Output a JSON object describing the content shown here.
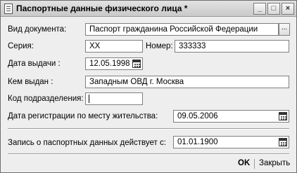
{
  "window": {
    "title": "Паспортные данные физического лица *"
  },
  "controls": {
    "minimize": "_",
    "maximize": "□",
    "close": "×"
  },
  "form": {
    "doc_type": {
      "label": "Вид документа:",
      "value": "Паспорт гражданина Российской Федерации",
      "button": "..."
    },
    "series": {
      "label": "Серия:",
      "value": "ХХ"
    },
    "number": {
      "label": "Номер:",
      "value": "333333"
    },
    "issue_date": {
      "label": "Дата выдачи :",
      "value": "12.05.1998"
    },
    "issued_by": {
      "label": "Кем выдан :",
      "value": "Западным ОВД г. Москва"
    },
    "division_code": {
      "label": "Код подразделения:",
      "value": ""
    },
    "registration_date": {
      "label": "Дата регистрации по месту жительства:",
      "value": "09.05.2006"
    },
    "valid_from": {
      "label": "Запись о паспортных данных действует с:",
      "value": "01.01.1900"
    }
  },
  "footer": {
    "ok": "OK",
    "close": "Закрыть"
  },
  "icons": {
    "window": "document-icon",
    "calendar": "calendar-icon"
  }
}
